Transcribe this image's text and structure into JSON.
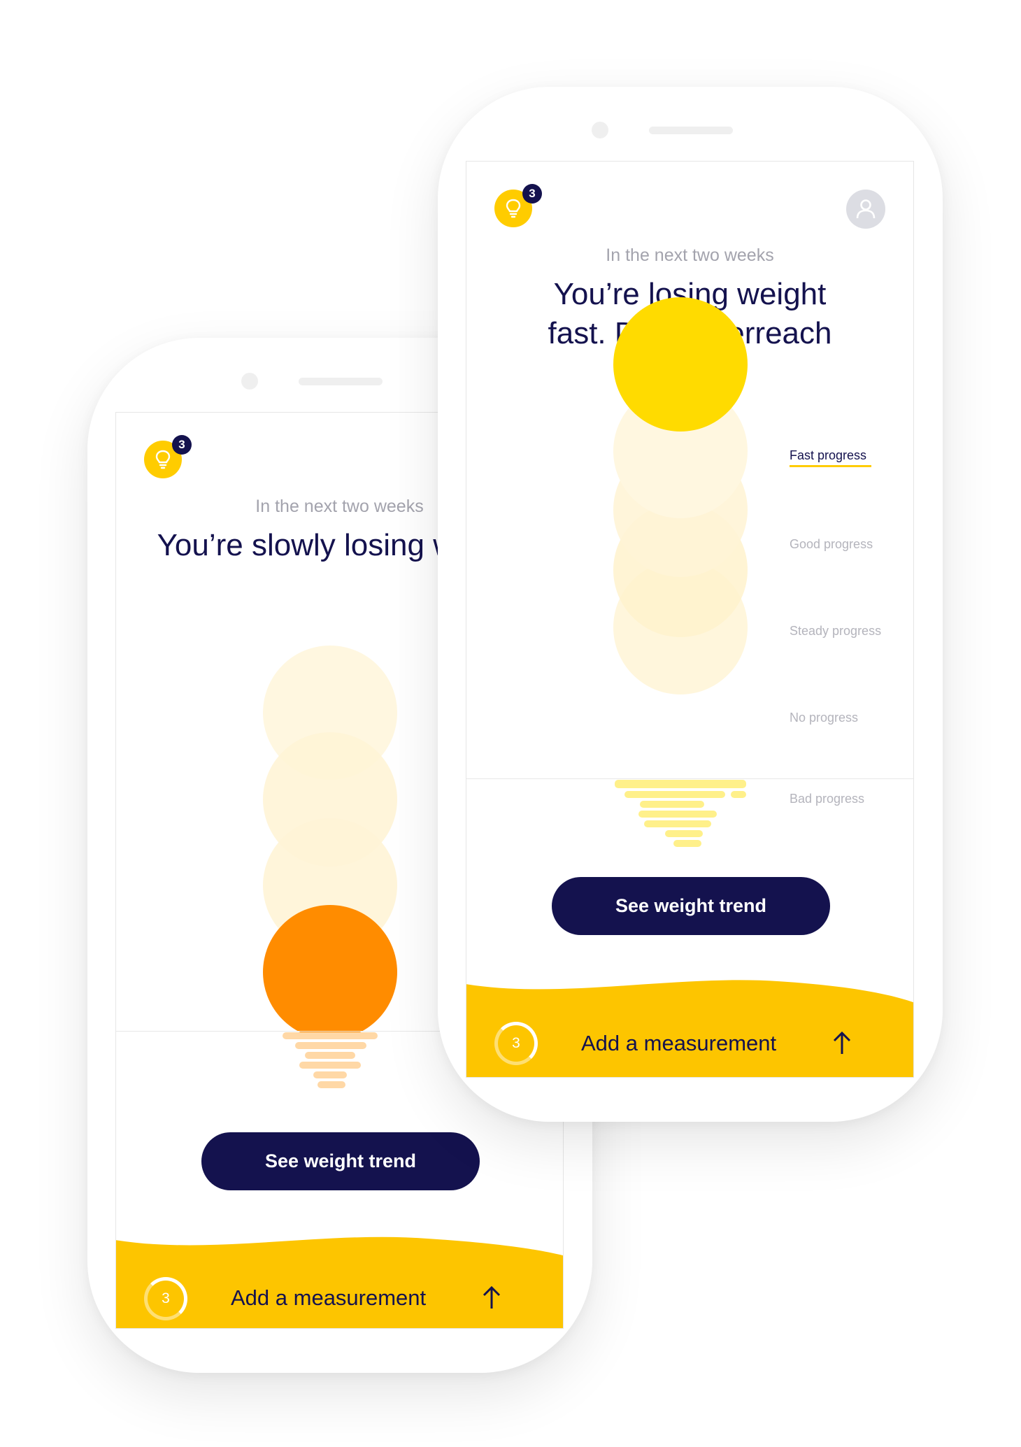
{
  "colors": {
    "navy": "#14124e",
    "yellow_accent": "#ffcc00",
    "sun_yellow": "#ffdb00",
    "sun_orange": "#ff8c00",
    "faded_circle": "#fff5d9",
    "grey_text": "#a3a3ad"
  },
  "left_phone": {
    "tips_count": "3",
    "subtitle": "In the next two weeks",
    "headline": "You’re slowly losing weight",
    "trend_button": "See weight trend",
    "measurement_count": "3",
    "add_measurement": "Add a measurement",
    "current_level": "Good progress"
  },
  "right_phone": {
    "tips_count": "3",
    "subtitle": "In the next two weeks",
    "headline_line1": "You’re losing weight",
    "headline_line2": "fast. Don’t overreach",
    "legend": [
      "Fast progress",
      "Good progress",
      "Steady progress",
      "No progress",
      "Bad progress"
    ],
    "active_level": "Fast progress",
    "trend_button": "See weight trend",
    "measurement_count": "3",
    "add_measurement": "Add a measurement"
  },
  "icons": [
    "lightbulb-icon",
    "user-icon",
    "arrow-up-icon",
    "progress-ring-icon"
  ]
}
